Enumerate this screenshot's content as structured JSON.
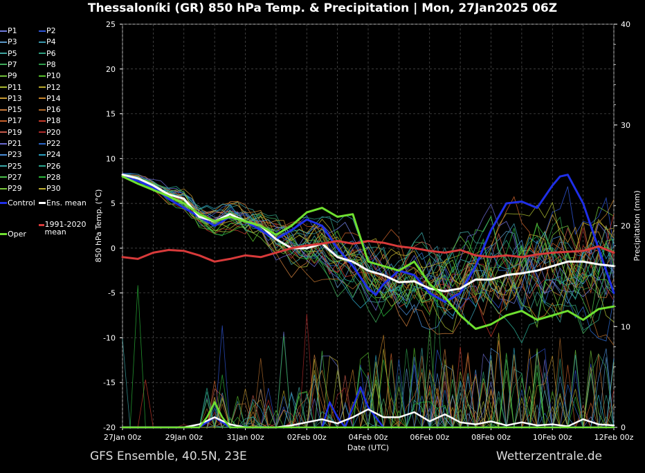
{
  "title": "Thessaloníki  (GR)  850 hPa Temp. & Precipitation | Mon, 27Jan2025 06Z",
  "footer_left": "GFS Ensemble, 40.5N, 23E",
  "footer_right": "Wetterzentrale.de",
  "chart_data": {
    "type": "line",
    "title": "Thessaloníki  (GR)  850 hPa Temp. & Precipitation | Mon, 27Jan2025 06Z",
    "xlabel": "Date (UTC)",
    "ylabel": "850 hPa Temp. (°C)",
    "y2label": "Precipitation (mm)",
    "x_ticks": [
      "27Jan 00z",
      "29Jan 00z",
      "31Jan 00z",
      "02Feb 00z",
      "04Feb 00z",
      "06Feb 00z",
      "08Feb 00z",
      "10Feb 00z",
      "12Feb 00z"
    ],
    "xlim_days": [
      0,
      16
    ],
    "ylim": [
      -20,
      25
    ],
    "y_ticks": [
      -20,
      -15,
      -10,
      -5,
      0,
      5,
      10,
      15,
      20,
      25
    ],
    "y2lim": [
      0,
      40
    ],
    "y2_ticks": [
      0,
      10,
      20,
      30,
      40
    ],
    "grid": true,
    "legend_placement": "left-outside",
    "legend": [
      {
        "name": "P1",
        "color": "#6f7bdc"
      },
      {
        "name": "P2",
        "color": "#2f56d8"
      },
      {
        "name": "P3",
        "color": "#5a98c8"
      },
      {
        "name": "P4",
        "color": "#3a9aae"
      },
      {
        "name": "P5",
        "color": "#3fa5a0"
      },
      {
        "name": "P6",
        "color": "#2fa080"
      },
      {
        "name": "P7",
        "color": "#3fab5a"
      },
      {
        "name": "P8",
        "color": "#2e9c4a"
      },
      {
        "name": "P9",
        "color": "#6fbf3a"
      },
      {
        "name": "P10",
        "color": "#56c02a"
      },
      {
        "name": "P11",
        "color": "#a8b830"
      },
      {
        "name": "P12",
        "color": "#b8a82a"
      },
      {
        "name": "P13",
        "color": "#c89a30"
      },
      {
        "name": "P14",
        "color": "#c8842a"
      },
      {
        "name": "P15",
        "color": "#c87a3a"
      },
      {
        "name": "P16",
        "color": "#b06a2a"
      },
      {
        "name": "P17",
        "color": "#c8602a"
      },
      {
        "name": "P18",
        "color": "#c83a2a"
      },
      {
        "name": "P19",
        "color": "#c85a4a"
      },
      {
        "name": "P20",
        "color": "#b02a2a"
      },
      {
        "name": "P21",
        "color": "#6a6ad0"
      },
      {
        "name": "P22",
        "color": "#2a66c8"
      },
      {
        "name": "P23",
        "color": "#4a8ed8"
      },
      {
        "name": "P24",
        "color": "#2aa0c0"
      },
      {
        "name": "P25",
        "color": "#3aa8a8"
      },
      {
        "name": "P26",
        "color": "#2aa890"
      },
      {
        "name": "P27",
        "color": "#4ac04a"
      },
      {
        "name": "P28",
        "color": "#2ab83a"
      },
      {
        "name": "P29",
        "color": "#7ac83a"
      },
      {
        "name": "P30",
        "color": "#c0b030"
      }
    ],
    "special_legend": [
      {
        "name": "Control",
        "color": "#1f2fe8"
      },
      {
        "name": "Ens. mean",
        "color": "#ffffff"
      },
      {
        "name": "1991-2020 mean",
        "color": "#d83a3a"
      },
      {
        "name": "Oper",
        "color": "#6fe030"
      }
    ],
    "series": [
      {
        "name": "Control",
        "axis": "temp",
        "color": "#1f2fe8",
        "x": [
          0,
          0.5,
          1,
          1.5,
          2,
          2.5,
          3,
          3.5,
          4,
          4.5,
          5,
          5.5,
          6,
          6.5,
          7,
          7.5,
          8,
          8.25,
          8.5,
          9,
          9.5,
          10,
          10.5,
          11,
          11.5,
          12,
          12.5,
          13,
          13.5,
          14,
          14.25,
          14.5,
          15,
          15.5,
          16
        ],
        "y": [
          8,
          7.5,
          6.8,
          5.5,
          4.5,
          3.5,
          2.5,
          3.5,
          3,
          2,
          1,
          2,
          3.2,
          2.5,
          0,
          -2,
          -4.5,
          -5.2,
          -4,
          -2.5,
          -3,
          -5,
          -6,
          -5,
          -2,
          2,
          5,
          5.2,
          4.5,
          7,
          8,
          8.2,
          5,
          0,
          -5
        ]
      },
      {
        "name": "Ens. mean",
        "axis": "temp",
        "color": "#ffffff",
        "x": [
          0,
          0.5,
          1,
          1.5,
          2,
          2.5,
          3,
          3.5,
          4,
          4.5,
          5,
          5.5,
          6,
          6.5,
          7,
          7.5,
          8,
          8.5,
          9,
          9.5,
          10,
          10.5,
          11,
          11.5,
          12,
          12.5,
          13,
          13.5,
          14,
          14.5,
          15,
          15.5,
          16
        ],
        "y": [
          8.2,
          7.8,
          7,
          6,
          5.5,
          3.5,
          3,
          3.8,
          3,
          2.5,
          1,
          0,
          0,
          0.5,
          -1,
          -1.5,
          -2.5,
          -3,
          -3.8,
          -3.7,
          -4.5,
          -4.8,
          -4.5,
          -3.5,
          -3.5,
          -3,
          -2.8,
          -2.5,
          -2,
          -1.5,
          -1.5,
          -1.8,
          -2
        ]
      },
      {
        "name": "1991-2020 mean",
        "axis": "temp",
        "color": "#d83a3a",
        "x": [
          0,
          0.5,
          1,
          1.5,
          2,
          2.5,
          3,
          3.5,
          4,
          4.5,
          5,
          5.5,
          6,
          6.5,
          7,
          7.5,
          8,
          8.5,
          9,
          9.5,
          10,
          10.5,
          11,
          11.5,
          12,
          12.5,
          13,
          13.5,
          14,
          14.5,
          15,
          15.5,
          16
        ],
        "y": [
          -1,
          -1.2,
          -0.5,
          -0.2,
          -0.3,
          -0.8,
          -1.5,
          -1.2,
          -0.8,
          -1,
          -0.5,
          0,
          0.3,
          0.5,
          0.8,
          0.5,
          0.8,
          0.6,
          0.2,
          0,
          -0.3,
          -0.5,
          -0.2,
          -0.8,
          -1,
          -0.8,
          -1,
          -0.7,
          -0.5,
          -0.4,
          -0.3,
          0.2,
          -0.5
        ]
      },
      {
        "name": "Oper",
        "axis": "temp",
        "color": "#6fe030",
        "x": [
          0,
          0.5,
          1,
          1.5,
          2,
          2.5,
          3,
          3.5,
          4,
          4.5,
          5,
          5.5,
          6,
          6.5,
          7,
          7.5,
          8,
          8.5,
          9,
          9.5,
          10,
          10.5,
          11,
          11.5,
          12,
          12.5,
          13,
          13.5,
          14,
          14.5,
          15,
          15.5,
          16
        ],
        "y": [
          8,
          7.2,
          6.5,
          5.8,
          5,
          3.8,
          3,
          3.5,
          3,
          2.5,
          1.5,
          2.5,
          4,
          4.5,
          3.5,
          3.8,
          -1.5,
          -2,
          -2.5,
          -1.5,
          -4,
          -5.5,
          -7.5,
          -9,
          -8.5,
          -7.5,
          -7,
          -8,
          -7.5,
          -7,
          -8,
          -6.8,
          -6.5
        ]
      },
      {
        "name": "Control precip",
        "axis": "precip",
        "color": "#1f2fe8",
        "x": [
          0,
          2,
          2.5,
          2.75,
          3,
          3.25,
          3.5,
          4,
          4.5,
          5,
          5.5,
          6,
          6.5,
          6.75,
          7,
          7.25,
          7.5,
          7.75,
          8,
          8.5,
          9,
          9.5,
          10,
          11,
          12,
          13,
          14,
          15,
          16
        ],
        "y": [
          0,
          0,
          0,
          0.5,
          1,
          0.5,
          0,
          0,
          0,
          0,
          0,
          0,
          0,
          2.5,
          1,
          0,
          2,
          4,
          2,
          0,
          0,
          0,
          0,
          0,
          0,
          0,
          0,
          0,
          0
        ]
      },
      {
        "name": "Ens. mean precip",
        "axis": "precip",
        "color": "#ffffff",
        "x": [
          0,
          2,
          2.5,
          3,
          3.5,
          4,
          4.5,
          5,
          5.5,
          6,
          6.5,
          7,
          7.5,
          8,
          8.5,
          9,
          9.5,
          10,
          10.5,
          11,
          11.5,
          12,
          12.5,
          13,
          13.5,
          14,
          14.5,
          15,
          15.5,
          16
        ],
        "y": [
          0,
          0,
          0.3,
          1,
          0.3,
          0,
          0,
          0,
          0.2,
          0.5,
          0.8,
          0.4,
          1,
          1.8,
          1,
          1,
          1.5,
          0.6,
          1.3,
          0.5,
          0.3,
          0.6,
          0.2,
          0.5,
          0.2,
          0.3,
          0.1,
          0.8,
          0.3,
          0.2
        ]
      },
      {
        "name": "Oper precip",
        "axis": "precip",
        "color": "#6fe030",
        "x": [
          0,
          2,
          2.5,
          2.75,
          3,
          3.25,
          3.5,
          4,
          16
        ],
        "y": [
          0,
          0,
          0,
          1,
          2.5,
          1,
          0,
          0,
          0
        ]
      }
    ]
  }
}
